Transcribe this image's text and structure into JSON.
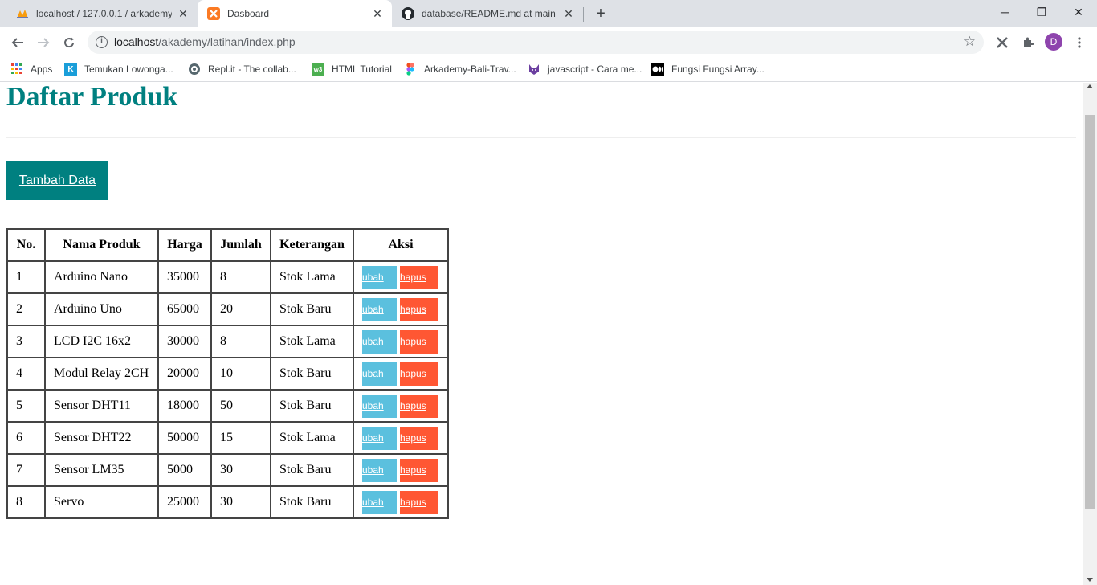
{
  "browser": {
    "tabs": [
      {
        "title": "localhost / 127.0.0.1 / arkademy /",
        "icon": "phpmyadmin-icon",
        "active": false
      },
      {
        "title": "Dasboard",
        "icon": "xampp-icon",
        "active": true
      },
      {
        "title": "database/README.md at main · t",
        "icon": "github-icon",
        "active": false
      }
    ],
    "url_host": "localhost",
    "url_path": "/akademy/latihan/index.php",
    "avatar_letter": "D",
    "bookmarks": [
      {
        "label": "Apps",
        "icon": "apps-grid-icon"
      },
      {
        "label": "Temukan Lowonga...",
        "icon": "k-logo-icon"
      },
      {
        "label": "Repl.it - The collab...",
        "icon": "replit-icon"
      },
      {
        "label": "HTML Tutorial",
        "icon": "w3schools-icon"
      },
      {
        "label": "Arkademy-Bali-Trav...",
        "icon": "figma-icon"
      },
      {
        "label": "javascript - Cara me...",
        "icon": "stackoverflow-cat-icon"
      },
      {
        "label": "Fungsi Fungsi Array...",
        "icon": "medium-icon"
      }
    ]
  },
  "page": {
    "title": "Daftar Produk",
    "add_button": "Tambah Data",
    "table": {
      "headers": [
        "No.",
        "Nama Produk",
        "Harga",
        "Jumlah",
        "Keterangan",
        "Aksi"
      ],
      "edit_label": "ubah",
      "delete_label": "hapus",
      "rows": [
        [
          "1",
          "Arduino Nano",
          "35000",
          "8",
          "Stok Lama"
        ],
        [
          "2",
          "Arduino Uno",
          "65000",
          "20",
          "Stok Baru"
        ],
        [
          "3",
          "LCD I2C 16x2",
          "30000",
          "8",
          "Stok Lama"
        ],
        [
          "4",
          "Modul Relay 2CH",
          "20000",
          "10",
          "Stok Baru"
        ],
        [
          "5",
          "Sensor DHT11",
          "18000",
          "50",
          "Stok Baru"
        ],
        [
          "6",
          "Sensor DHT22",
          "50000",
          "15",
          "Stok Lama"
        ],
        [
          "7",
          "Sensor LM35",
          "5000",
          "30",
          "Stok Baru"
        ],
        [
          "8",
          "Servo",
          "25000",
          "30",
          "Stok Baru"
        ]
      ]
    }
  },
  "colors": {
    "heading": "#008080",
    "add_button_bg": "#008080",
    "edit_button_bg": "#5bc0de",
    "delete_button_bg": "#ff5733"
  }
}
